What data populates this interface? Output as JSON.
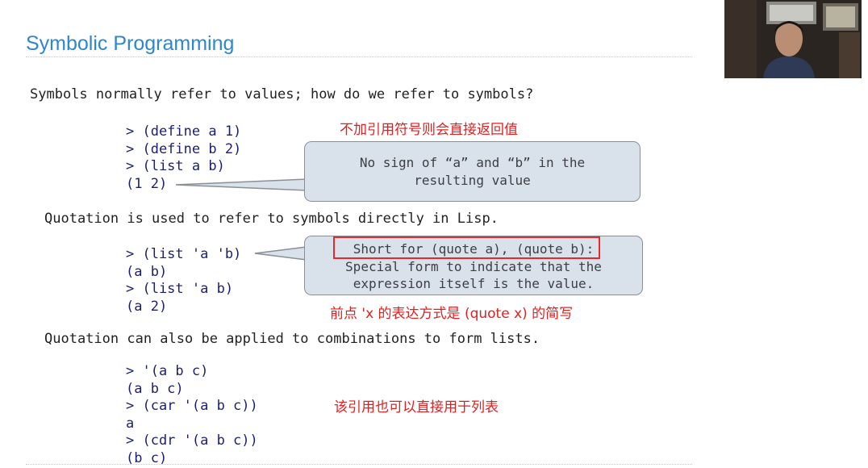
{
  "slide": {
    "title": "Symbolic Programming",
    "intro": "Symbols normally refer to values; how do we refer to symbols?",
    "quotation_intro": "Quotation is used to refer to symbols directly in Lisp.",
    "combination_intro": "Quotation can also be applied to combinations to form lists."
  },
  "code_block_1": [
    "> (define a 1)",
    "> (define b 2)",
    "> (list a b)",
    "(1 2)"
  ],
  "code_block_2": [
    "> (list 'a 'b)",
    "(a b)",
    "> (list 'a b)",
    "(a 2)"
  ],
  "code_block_3": [
    "> '(a b c)",
    "(a b c)",
    "> (car '(a b c))",
    "a",
    "> (cdr '(a b c))",
    "(b c)"
  ],
  "callout_1": {
    "line1": "No sign of “a” and “b” in the",
    "line2": "resulting value"
  },
  "callout_2": {
    "line1": "Short for (quote a), (quote b):",
    "line2": "Special form to indicate that the",
    "line3": "expression itself is the value."
  },
  "annotations": {
    "note_1": "不加引用符号则会直接返回值",
    "note_2": "前点 'x 的表达方式是 (quote x) 的简写",
    "note_3": "该引用也可以直接用于列表"
  },
  "colors": {
    "title": "#2e86cf",
    "code": "#1c1f6e",
    "annotation": "#e02020",
    "callout_bg": "#d9e1ea",
    "highlight": "#e8282b"
  }
}
